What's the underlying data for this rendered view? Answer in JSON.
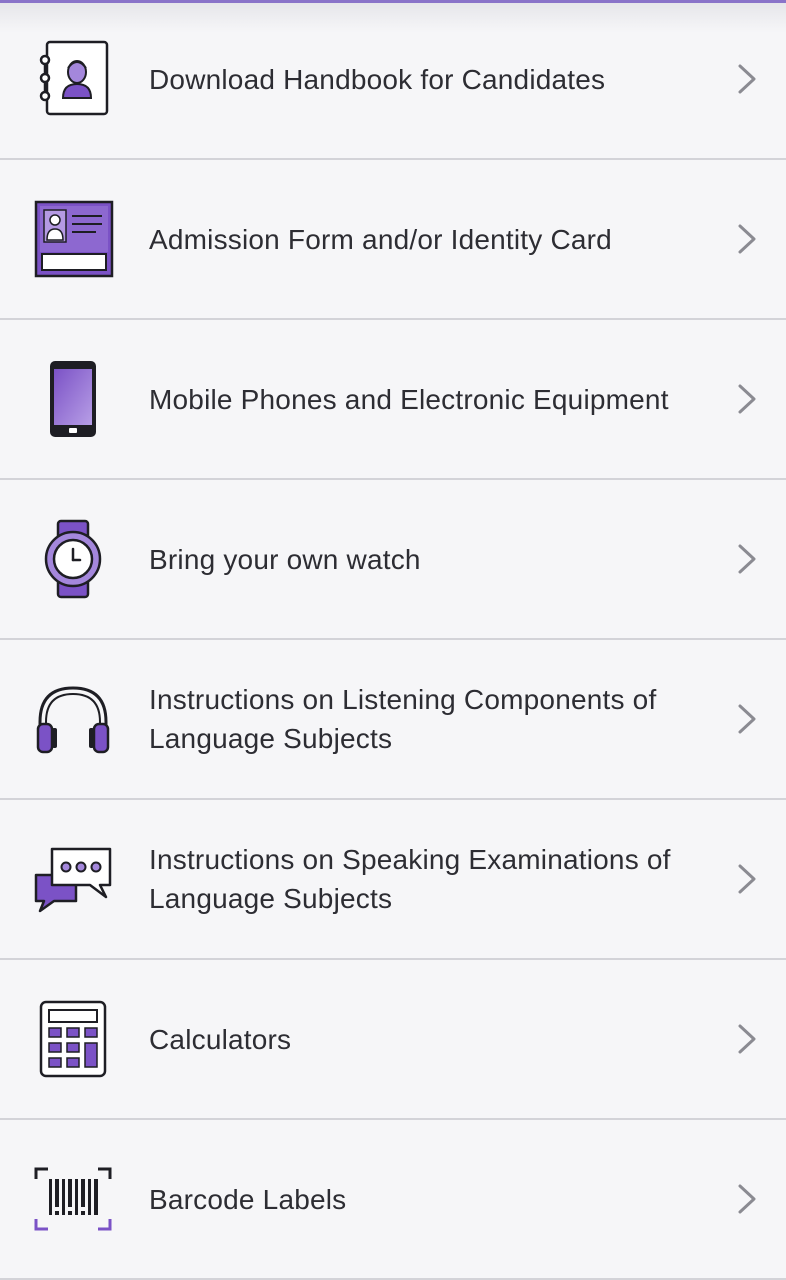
{
  "colors": {
    "accent": "#7b52c6",
    "accent_light": "#a487dc",
    "icon_stroke": "#1e1e24",
    "text": "#2d2d33",
    "divider": "#d3d3d8",
    "chevron": "#8b8b92",
    "background": "#f6f6f8"
  },
  "items": [
    {
      "label": "Download Handbook for Candidates",
      "icon": "handbook-icon"
    },
    {
      "label": "Admission Form and/or Identity Card",
      "icon": "id-card-icon"
    },
    {
      "label": "Mobile Phones and Electronic Equipment",
      "icon": "mobile-phone-icon"
    },
    {
      "label": "Bring your own watch",
      "icon": "watch-icon"
    },
    {
      "label": "Instructions on Listening Components of Language Subjects",
      "icon": "headphones-icon"
    },
    {
      "label": "Instructions on Speaking Examinations of Language Subjects",
      "icon": "speech-bubble-icon"
    },
    {
      "label": "Calculators",
      "icon": "calculator-icon"
    },
    {
      "label": "Barcode Labels",
      "icon": "barcode-icon"
    }
  ]
}
